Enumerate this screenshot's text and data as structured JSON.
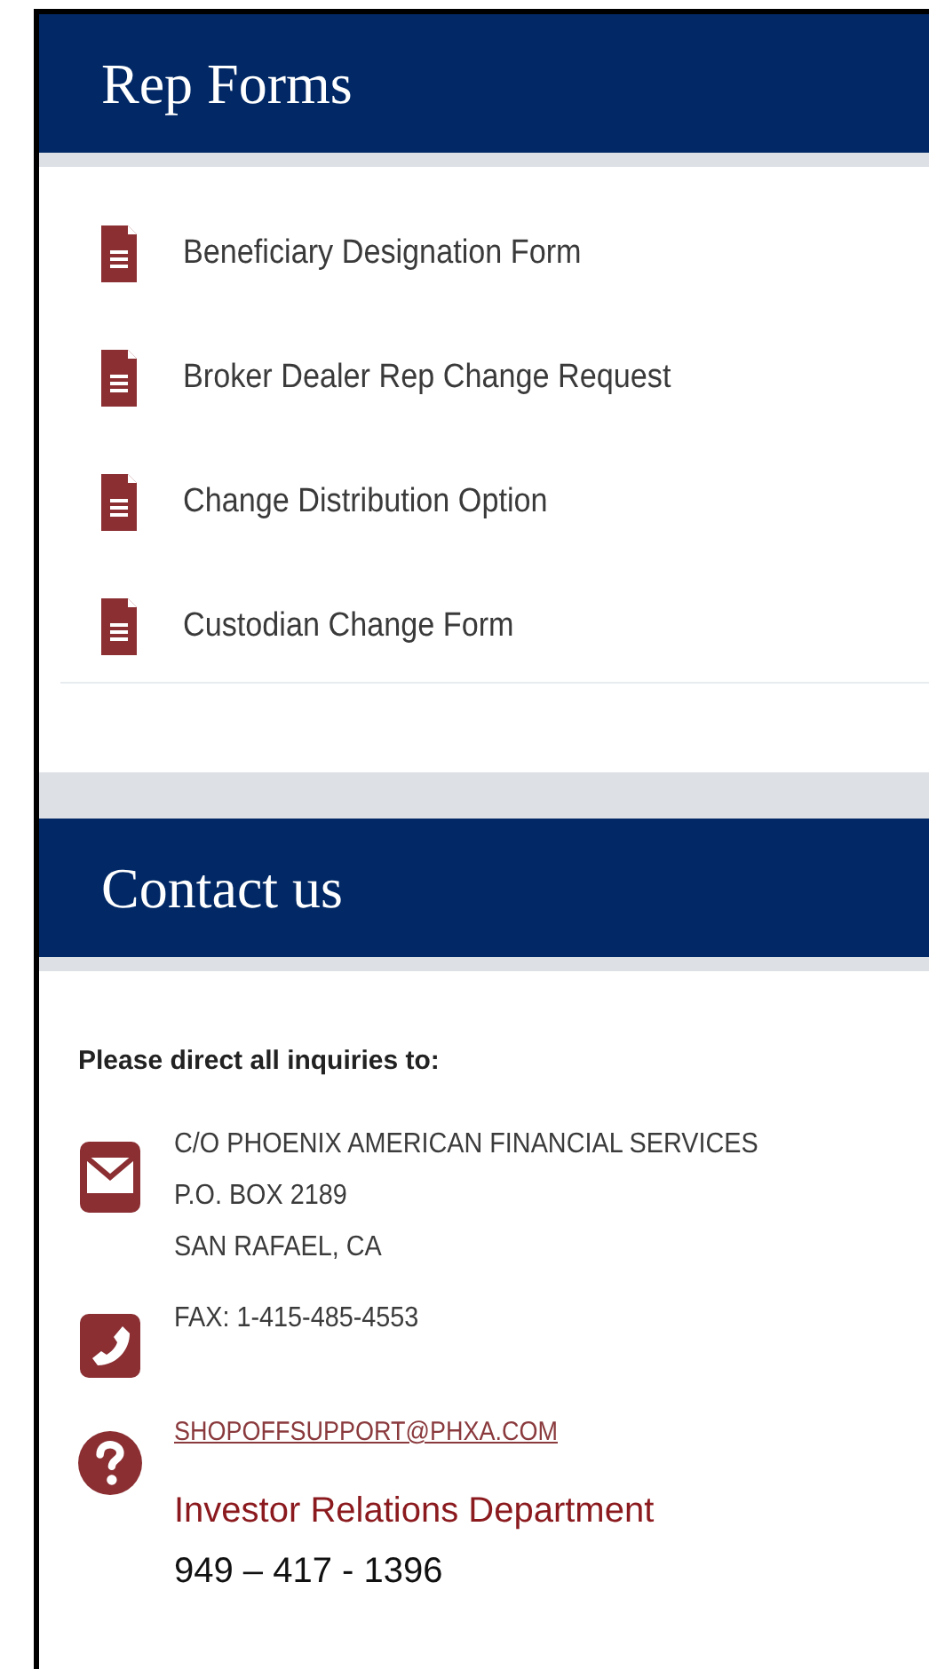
{
  "rep_forms": {
    "title": "Rep Forms",
    "items": [
      "Beneficiary Designation Form",
      "Broker Dealer Rep Change Request",
      "Change Distribution Option",
      "Custodian Change Form"
    ]
  },
  "contact": {
    "title": "Contact us",
    "intro": "Please direct all inquiries to:",
    "entries": [
      {
        "kind": "mail",
        "lines": [
          "C/O PHOENIX AMERICAN FINANCIAL SERVICES",
          "P.O. BOX 2189",
          "SAN RAFAEL, CA"
        ]
      },
      {
        "kind": "phone",
        "lines": [
          "FAX: 1-415-485-4553"
        ]
      },
      {
        "kind": "help",
        "link": "SHOPOFFSUPPORT@PHXA.COM",
        "department": "Investor Relations Department",
        "phone": "949 – 417 - 1396"
      }
    ]
  }
}
